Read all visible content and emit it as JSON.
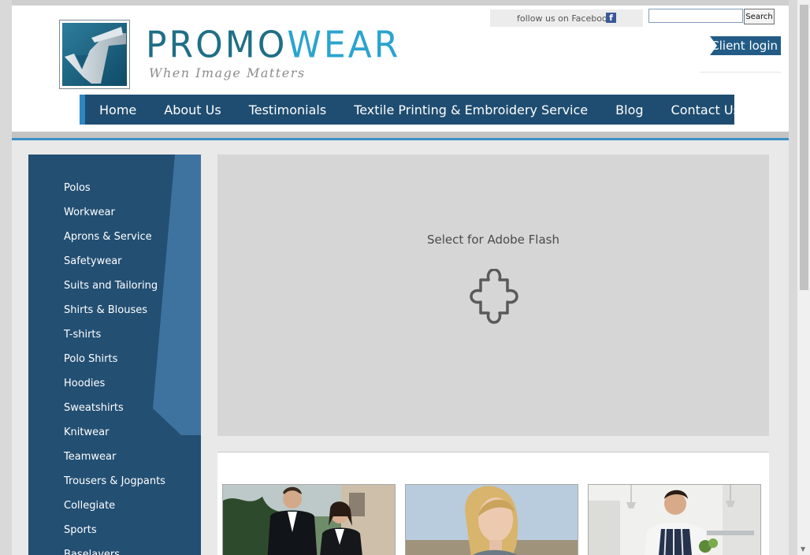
{
  "brand": {
    "name_part1": "PROMO",
    "name_part2": "WEAR",
    "tagline": "When Image Matters",
    "logo_icon": "promowear-logo-icon",
    "colors": {
      "dark_teal": "#1f6f86",
      "light_blue": "#2aa4cf",
      "nav_blue": "#1f4d71"
    }
  },
  "header": {
    "facebook_text": "follow us on Facebook",
    "facebook_icon": "facebook-icon",
    "search_value": "",
    "search_button": "Search",
    "client_login": "Client login"
  },
  "nav": {
    "items": [
      "Home",
      "About Us",
      "Testimonials",
      "Textile Printing & Embroidery Service",
      "Blog",
      "Contact Us"
    ]
  },
  "sidebar": {
    "items": [
      "Polos",
      "Workwear",
      "Aprons & Service",
      "Safetywear",
      "Suits and Tailoring",
      "Shirts & Blouses",
      "T-shirts",
      "Polo Shirts",
      "Hoodies",
      "Sweatshirts",
      "Knitwear",
      "Teamwear",
      "Trousers & Jogpants",
      "Collegiate",
      "Sports",
      "Baselayers"
    ]
  },
  "flash": {
    "text": "Select for Adobe Flash",
    "icon": "puzzle-plugin-icon"
  },
  "photos": [
    {
      "name": "photo-suits",
      "subject": "business-people"
    },
    {
      "name": "photo-woman",
      "subject": "blonde-woman"
    },
    {
      "name": "photo-chef",
      "subject": "chef-apron"
    }
  ]
}
